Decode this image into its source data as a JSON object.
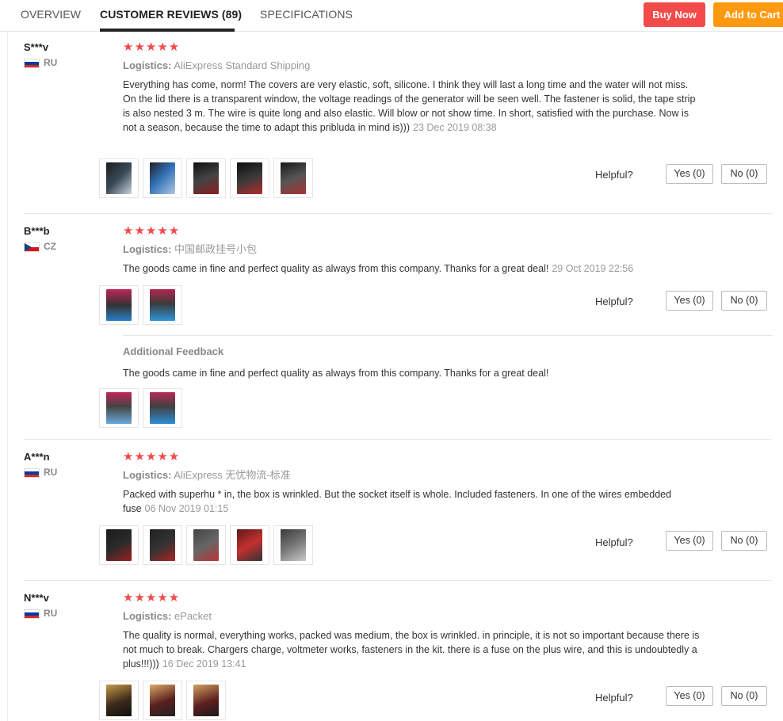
{
  "tabs": [
    {
      "label": "OVERVIEW"
    },
    {
      "label": "CUSTOMER REVIEWS (89)"
    },
    {
      "label": "SPECIFICATIONS"
    }
  ],
  "buttons": {
    "buy_now": "Buy Now",
    "add_to_cart": "Add to Cart"
  },
  "helpful_label": "Helpful?",
  "logistics_label": "Logistics:",
  "reviews": [
    {
      "user": "S***v",
      "country": "RU",
      "stars": "★★★★★",
      "rating": 5,
      "logistics": "AliExpress Standard Shipping",
      "text": "Everything has come, norm! The covers are very elastic, soft, silicone. I think they will last a long time and the water will not miss. On the lid there is a transparent window, the voltage readings of the generator will be seen well. The fastener is solid, the tape strip is also nested 3 m. The wire is quite long and also elastic. Will blow or not show time. In short, satisfied with the purchase. Now is not a season, because the time to adapt this pribluda in mind is)))",
      "date": "23 Dec 2019 08:38",
      "yes": "Yes (0)",
      "no": "No (0)",
      "photo_count": 5
    },
    {
      "user": "B***b",
      "country": "CZ",
      "stars": "★★★★★",
      "rating": 5,
      "logistics": "中国邮政挂号小包",
      "text": "The goods came in fine and perfect quality as always from this company. Thanks for a great deal!",
      "date": "29 Oct 2019 22:56",
      "yes": "Yes (0)",
      "no": "No (0)",
      "photo_count": 2,
      "additional": {
        "title": "Additional Feedback",
        "text": "The goods came in fine and perfect quality as always from this company. Thanks for a great deal!",
        "photo_count": 2
      }
    },
    {
      "user": "A***n",
      "country": "RU",
      "stars": "★★★★★",
      "rating": 5,
      "logistics": "AliExpress 无忧物流-标准",
      "text": "Packed with superhu * in, the box is wrinkled. But the socket itself is whole. Included fasteners. In one of the wires embedded fuse",
      "date": "06 Nov 2019 01:15",
      "yes": "Yes (0)",
      "no": "No (0)",
      "photo_count": 5
    },
    {
      "user": "N***v",
      "country": "RU",
      "stars": "★★★★★",
      "rating": 5,
      "logistics": "ePacket",
      "text": "The quality is normal, everything works, packed was medium, the box is wrinkled. in principle, it is not so important because there is not much to break. Chargers charge, voltmeter works, fasteners in the kit. there is a fuse on the plus wire, and this is undoubtedly a plus!!!)))",
      "date": "16 Dec 2019 13:41",
      "yes": "Yes (0)",
      "no": "No (0)",
      "photo_count": 3
    }
  ]
}
